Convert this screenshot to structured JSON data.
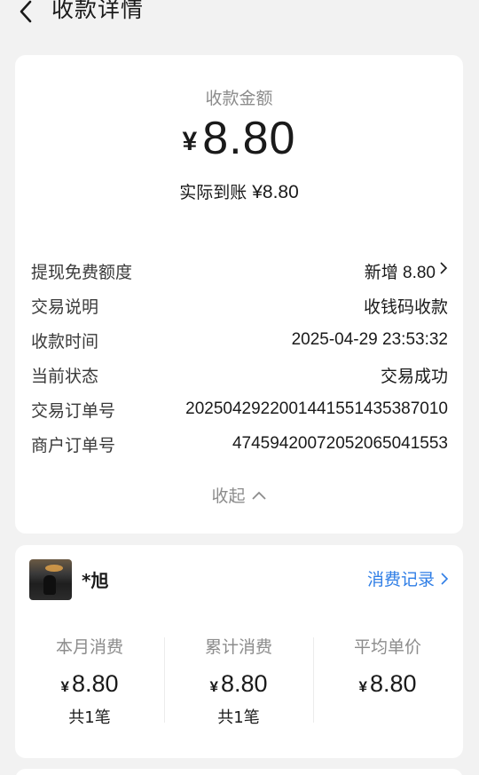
{
  "header": {
    "title": "收款详情"
  },
  "summary": {
    "amount_label": "收款金额",
    "currency": "¥",
    "amount": "8.80",
    "received_label": "实际到账",
    "received_value": "¥8.80"
  },
  "details": [
    {
      "label": "提现免费额度",
      "value": "新增 8.80",
      "has_arrow": true
    },
    {
      "label": "交易说明",
      "value": "收钱码收款"
    },
    {
      "label": "收款时间",
      "value": "2025-04-29 23:53:32"
    },
    {
      "label": "当前状态",
      "value": "交易成功"
    },
    {
      "label": "交易订单号",
      "value": "20250429220014415514353870​10"
    },
    {
      "label": "商户订单号",
      "value": "47459420072052065041553"
    }
  ],
  "collapse_label": "收起",
  "customer": {
    "name": "*旭",
    "history_label": "消费记录",
    "stats": [
      {
        "title": "本月消费",
        "currency": "¥",
        "value": "8.80",
        "count": "共1笔"
      },
      {
        "title": "累计消费",
        "currency": "¥",
        "value": "8.80",
        "count": "共1笔"
      },
      {
        "title": "平均单价",
        "currency": "¥",
        "value": "8.80",
        "count": ""
      }
    ]
  },
  "colors": {
    "link": "#2f7ee6",
    "muted": "#8c8c8c",
    "background": "#f2f2f2"
  }
}
